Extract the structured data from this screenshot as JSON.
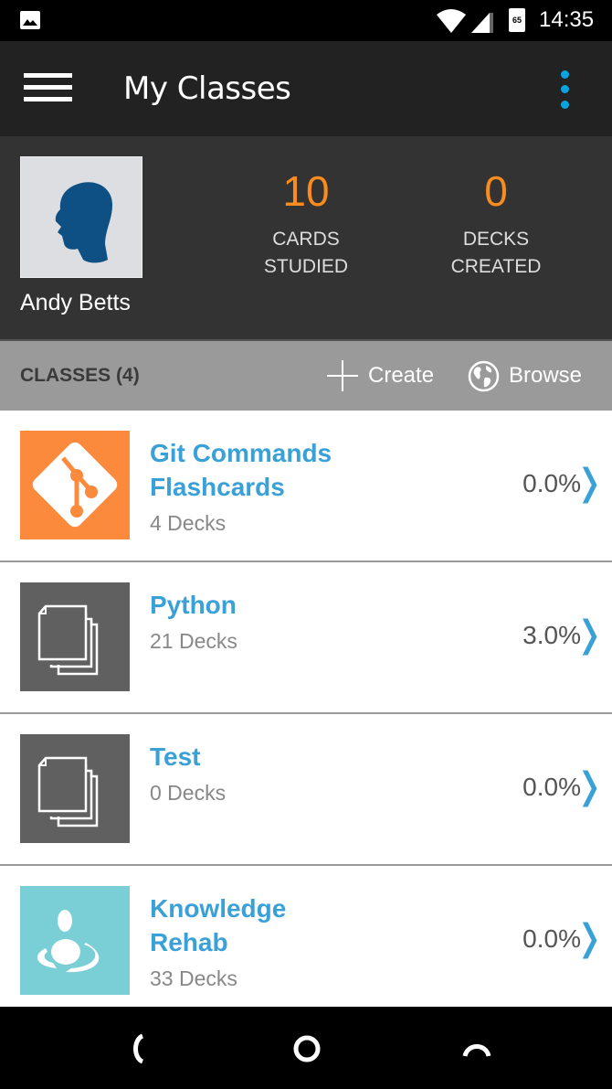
{
  "status_bar": {
    "time": "14:35",
    "battery": "65",
    "icons": [
      "image-notification-icon",
      "wifi-icon",
      "cell-signal-icon",
      "battery-icon"
    ]
  },
  "app_bar": {
    "title": "My Classes",
    "menu_icon": "hamburger-menu-icon",
    "overflow_icon": "more-vert-icon",
    "accent_color": "#0aa3e0"
  },
  "profile": {
    "name": "Andy Betts",
    "stats": [
      {
        "value": "10",
        "label_line1": "CARDS",
        "label_line2": "STUDIED"
      },
      {
        "value": "0",
        "label_line1": "DECKS",
        "label_line2": "CREATED"
      }
    ],
    "stat_color": "#f98c1e"
  },
  "classes_header": {
    "title": "CLASSES (4)",
    "create_label": "Create",
    "browse_label": "Browse"
  },
  "classes": [
    {
      "name_line1": "Git Commands",
      "name_line2": "Flashcards",
      "decks": "4 Decks",
      "progress": "0.0%",
      "thumb": "git-logo-icon",
      "thumb_color": "#fc8a3c"
    },
    {
      "name_line1": "Python",
      "name_line2": "",
      "decks": "21 Decks",
      "progress": "3.0%",
      "thumb": "stacked-cards-icon",
      "thumb_color": "#606060"
    },
    {
      "name_line1": "Test",
      "name_line2": "",
      "decks": "0 Decks",
      "progress": "0.0%",
      "thumb": "stacked-cards-icon",
      "thumb_color": "#606060"
    },
    {
      "name_line1": "Knowledge",
      "name_line2": "Rehab",
      "decks": "33 Decks",
      "progress": "0.0%",
      "thumb": "person-ripple-icon",
      "thumb_color": "#7acfd6"
    }
  ],
  "chevron": "❭",
  "nav_bar": {
    "buttons": [
      "back-icon",
      "home-icon",
      "recents-icon"
    ]
  }
}
